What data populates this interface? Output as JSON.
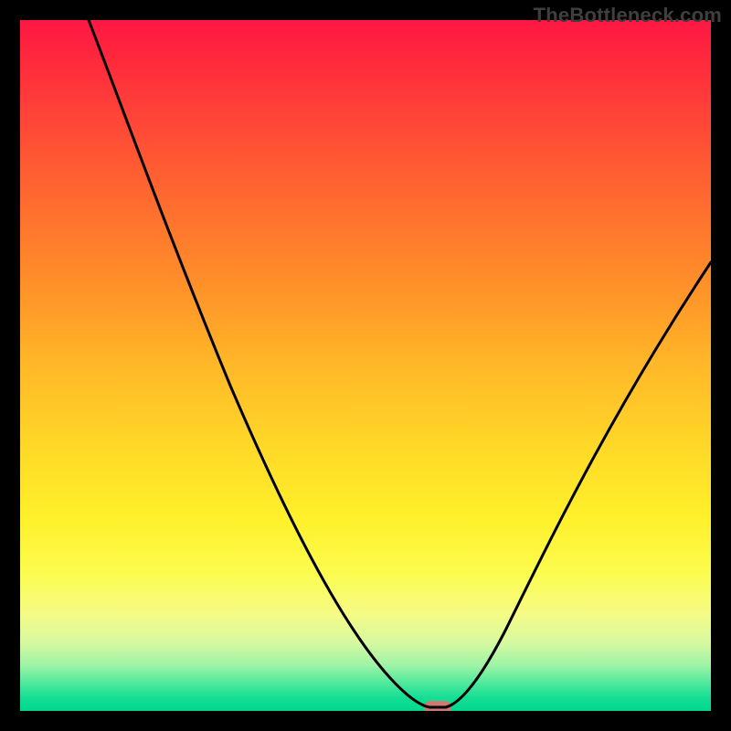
{
  "watermark": "TheBottleneck.com",
  "colors": {
    "frame_background": "#000000",
    "curve_stroke": "#000000",
    "marker_fill": "#cf7a70",
    "watermark_text": "#3f3f3f",
    "gradient_stops": [
      "#ff1744",
      "#ff2a3c",
      "#ff4438",
      "#ff6a2f",
      "#ff8f29",
      "#ffb828",
      "#ffd928",
      "#fff02a",
      "#fcfc4e",
      "#f5fb86",
      "#d8f9a0",
      "#9cf3a6",
      "#4fe99c",
      "#16df94",
      "#00d78f"
    ]
  },
  "chart_data": {
    "type": "line",
    "title": "",
    "xlabel": "",
    "ylabel": "",
    "xlim": [
      0,
      100
    ],
    "ylim": [
      0,
      100
    ],
    "grid": false,
    "notes": "Bottleneck-style V-curve on a red→green vertical gradient. x is normalized horizontal position (0=left edge of plot, 100=right). y is normalized height above the green baseline (0=bottom, 100=top). Values estimated from pixels.",
    "series": [
      {
        "name": "left-branch",
        "x": [
          10,
          15,
          20,
          25,
          30,
          35,
          40,
          45,
          50,
          53,
          55,
          57,
          58.5
        ],
        "y": [
          100,
          92,
          83,
          74,
          64,
          54,
          43,
          32,
          20,
          12,
          6,
          2,
          0.5
        ]
      },
      {
        "name": "right-branch",
        "x": [
          62,
          64,
          67,
          71,
          76,
          82,
          88,
          94,
          100
        ],
        "y": [
          0.5,
          3,
          8,
          16,
          26,
          38,
          49,
          58,
          65
        ]
      }
    ],
    "marker": {
      "name": "optimum",
      "x": 60,
      "y": 0.5,
      "shape": "rounded-bar",
      "color": "#cf7a70"
    }
  }
}
